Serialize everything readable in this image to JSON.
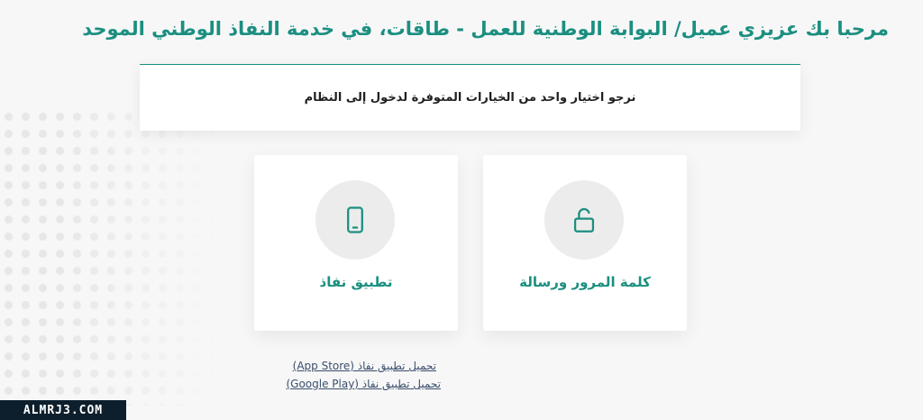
{
  "page": {
    "title": "مرحبا بك عزيزي عميل/ البوابة الوطنية للعمل - طاقات، في خدمة النفاذ الوطني الموحد"
  },
  "instruction": {
    "text": "نرجو اختيار واحد من الخيارات المتوفرة لدخول إلى النظام"
  },
  "options": [
    {
      "label": "تطبيق نفاذ",
      "icon": "mobile-phone-icon"
    },
    {
      "label": "كلمة المرور ورسالة",
      "icon": "unlock-icon"
    }
  ],
  "links": {
    "app_store": "تحميل تطبيق نفاذ (App Store)",
    "google_play": "تحميل تطبيق نفاذ (Google Play)"
  },
  "watermark": "ALMRJ3.COM",
  "colors": {
    "accent": "#1b8f80",
    "background": "#f7f7f8",
    "card": "#ffffff",
    "icon_circle": "#ececec"
  }
}
